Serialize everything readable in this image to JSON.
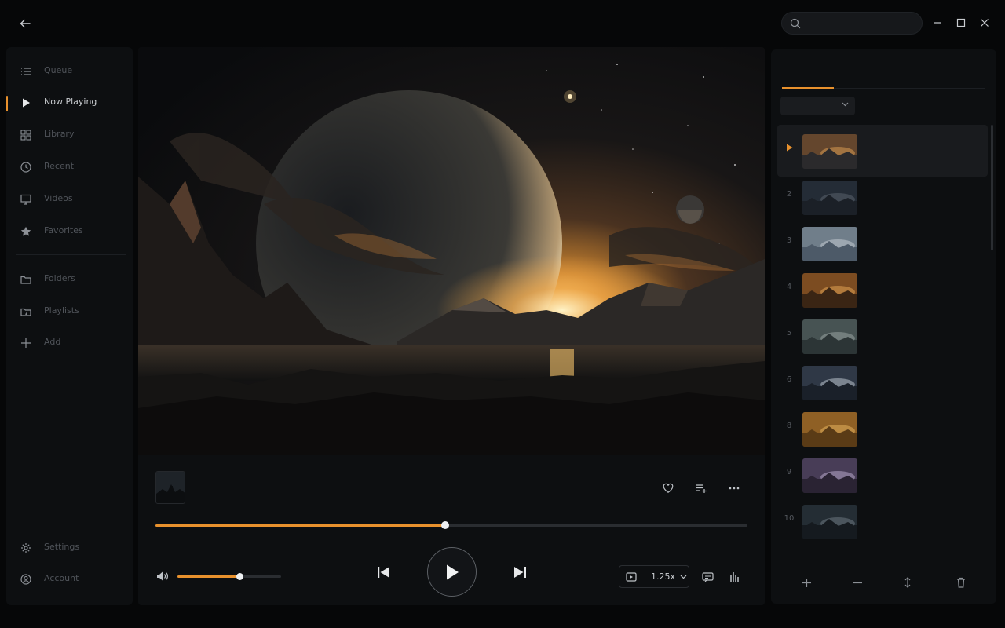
{
  "window": {
    "search_placeholder": ""
  },
  "sidebar": {
    "items": [
      {
        "label": "Queue",
        "icon": "list-icon"
      },
      {
        "label": "Now Playing",
        "icon": "play-icon"
      },
      {
        "label": "Library",
        "icon": "grid-icon"
      },
      {
        "label": "Recent",
        "icon": "clock-icon"
      },
      {
        "label": "Videos",
        "icon": "monitor-icon"
      },
      {
        "label": "Favorites",
        "icon": "star-icon"
      },
      {
        "label": "Folders",
        "icon": "folder-icon"
      },
      {
        "label": "Playlists",
        "icon": "folder-music-icon"
      },
      {
        "label": "Add",
        "icon": "plus-icon"
      }
    ],
    "bottom": [
      {
        "label": "Settings",
        "icon": "gear-icon"
      },
      {
        "label": "Account",
        "icon": "user-icon"
      }
    ]
  },
  "now_playing": {
    "title": "",
    "artist": "",
    "current_time": "",
    "duration": "",
    "progress": 0.49,
    "volume": 0.6,
    "speed": "1.25x"
  },
  "panel": {
    "tabs": [
      "",
      "",
      ""
    ],
    "sort_value": "",
    "rows": [
      {
        "num": "",
        "title": "",
        "subtitle": "",
        "duration": "",
        "active": true
      },
      {
        "num": "2",
        "title": "",
        "subtitle": "",
        "duration": ""
      },
      {
        "num": "3",
        "title": "",
        "subtitle": "",
        "duration": ""
      },
      {
        "num": "4",
        "title": "",
        "subtitle": "",
        "duration": ""
      },
      {
        "num": "5",
        "title": "",
        "subtitle": "",
        "duration": ""
      },
      {
        "num": "6",
        "title": "",
        "subtitle": "",
        "duration": ""
      },
      {
        "num": "8",
        "title": "",
        "subtitle": "",
        "duration": ""
      },
      {
        "num": "9",
        "title": "",
        "subtitle": "",
        "duration": ""
      },
      {
        "num": "10",
        "title": "",
        "subtitle": "",
        "duration": ""
      }
    ]
  },
  "colors": {
    "accent": "#e8912d",
    "background": "#060708",
    "surface": "#0d0f11"
  }
}
